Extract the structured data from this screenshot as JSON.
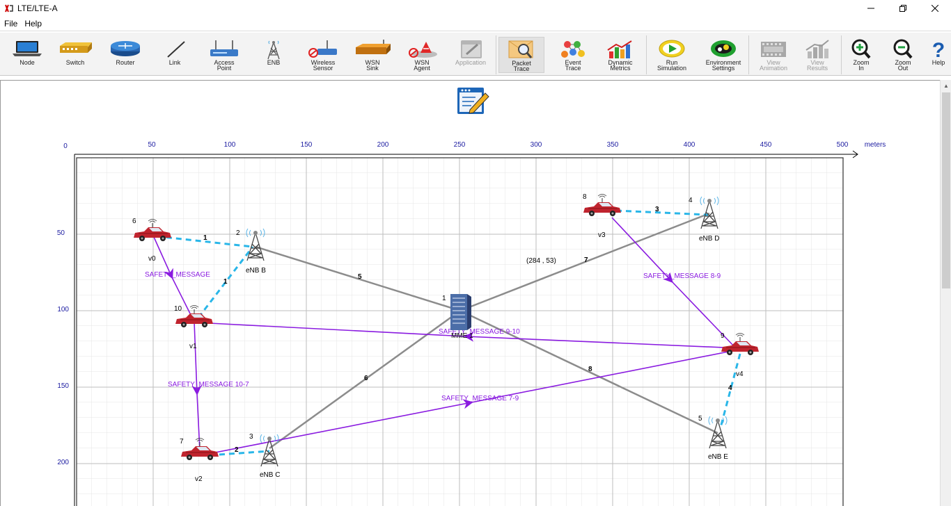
{
  "window": {
    "title": "LTE/LTE-A"
  },
  "menu": [
    "File",
    "Help"
  ],
  "toolbar": [
    {
      "label": "Node",
      "icon": "laptop-icon"
    },
    {
      "label": "Switch",
      "icon": "switch-icon"
    },
    {
      "label": "Router",
      "icon": "router-icon"
    },
    {
      "label": "Link",
      "icon": "link-icon"
    },
    {
      "label": "Access Point",
      "icon": "access-point-icon"
    },
    {
      "label": "ENB",
      "icon": "enb-tower-icon"
    },
    {
      "label": "Wireless Sensor",
      "icon": "wireless-sensor-icon"
    },
    {
      "label": "WSN Sink",
      "icon": "wsn-sink-icon"
    },
    {
      "label": "WSN Agent",
      "icon": "wsn-agent-icon"
    },
    {
      "label": "Application",
      "icon": "application-icon",
      "disabled": true
    },
    {
      "label": "Packet Trace",
      "icon": "packet-trace-icon"
    },
    {
      "label": "Event Trace",
      "icon": "event-trace-icon"
    },
    {
      "label": "Dynamic Metrics",
      "icon": "dynamic-metrics-icon"
    },
    {
      "label": "Run Simulation",
      "icon": "run-simulation-icon"
    },
    {
      "label": "Environment Settings",
      "icon": "environment-settings-icon"
    },
    {
      "label": "View Animation",
      "icon": "view-animation-icon",
      "disabled": true
    },
    {
      "label": "View Results",
      "icon": "view-results-icon",
      "disabled": true
    },
    {
      "label": "Zoom In",
      "icon": "zoom-in-icon"
    },
    {
      "label": "Zoom Out",
      "icon": "zoom-out-icon"
    },
    {
      "label": "Help",
      "icon": "help-icon"
    }
  ],
  "ruler": {
    "x_ticks": [
      "0",
      "50",
      "100",
      "150",
      "200",
      "250",
      "300",
      "350",
      "400",
      "450",
      "500"
    ],
    "x_unit": "meters",
    "y_ticks": [
      "50",
      "100",
      "150",
      "200"
    ]
  },
  "coordinate_readout": "(284 , 53)",
  "devices": [
    {
      "id": "6",
      "name": "v0",
      "type": "vehicle"
    },
    {
      "id": "10",
      "name": "v1",
      "type": "vehicle"
    },
    {
      "id": "7",
      "name": "v2",
      "type": "vehicle"
    },
    {
      "id": "8",
      "name": "v3",
      "type": "vehicle"
    },
    {
      "id": "9",
      "name": "v4",
      "type": "vehicle"
    },
    {
      "id": "2",
      "name": "eNB B",
      "type": "enb"
    },
    {
      "id": "3",
      "name": "eNB C",
      "type": "enb"
    },
    {
      "id": "4",
      "name": "eNB D",
      "type": "enb"
    },
    {
      "id": "5",
      "name": "eNB E",
      "type": "enb"
    },
    {
      "id": "1",
      "name": "MME 1",
      "type": "mme"
    }
  ],
  "links": [
    {
      "id": "1",
      "kind": "wireless",
      "label": "1"
    },
    {
      "id": "1b",
      "kind": "wireless",
      "label": "1"
    },
    {
      "id": "2",
      "kind": "wireless",
      "label": "2"
    },
    {
      "id": "3",
      "kind": "wireless",
      "label": "3"
    },
    {
      "id": "4",
      "kind": "wireless",
      "label": "4"
    },
    {
      "id": "5",
      "kind": "wired",
      "label": "5"
    },
    {
      "id": "6",
      "kind": "wired",
      "label": "6"
    },
    {
      "id": "7",
      "kind": "wired",
      "label": "7"
    },
    {
      "id": "8",
      "kind": "wired",
      "label": "8"
    }
  ],
  "applications": [
    {
      "label": "SAFETY_MESSAGE"
    },
    {
      "label": "SAFETY_MESSAGE 10-7"
    },
    {
      "label": "SAFETY_MESSAGE 8-9"
    },
    {
      "label": "SAFETY_MESSAGE 9-10"
    },
    {
      "label": "SAFETY_MESSAGE 7-9"
    }
  ],
  "colors": {
    "wireless_link": "#29b6e8",
    "wired_link": "#8c8c8c",
    "application_flow": "#8a1be0",
    "ruler_text": "#1a1aa0",
    "vehicle_body": "#c0242e"
  }
}
